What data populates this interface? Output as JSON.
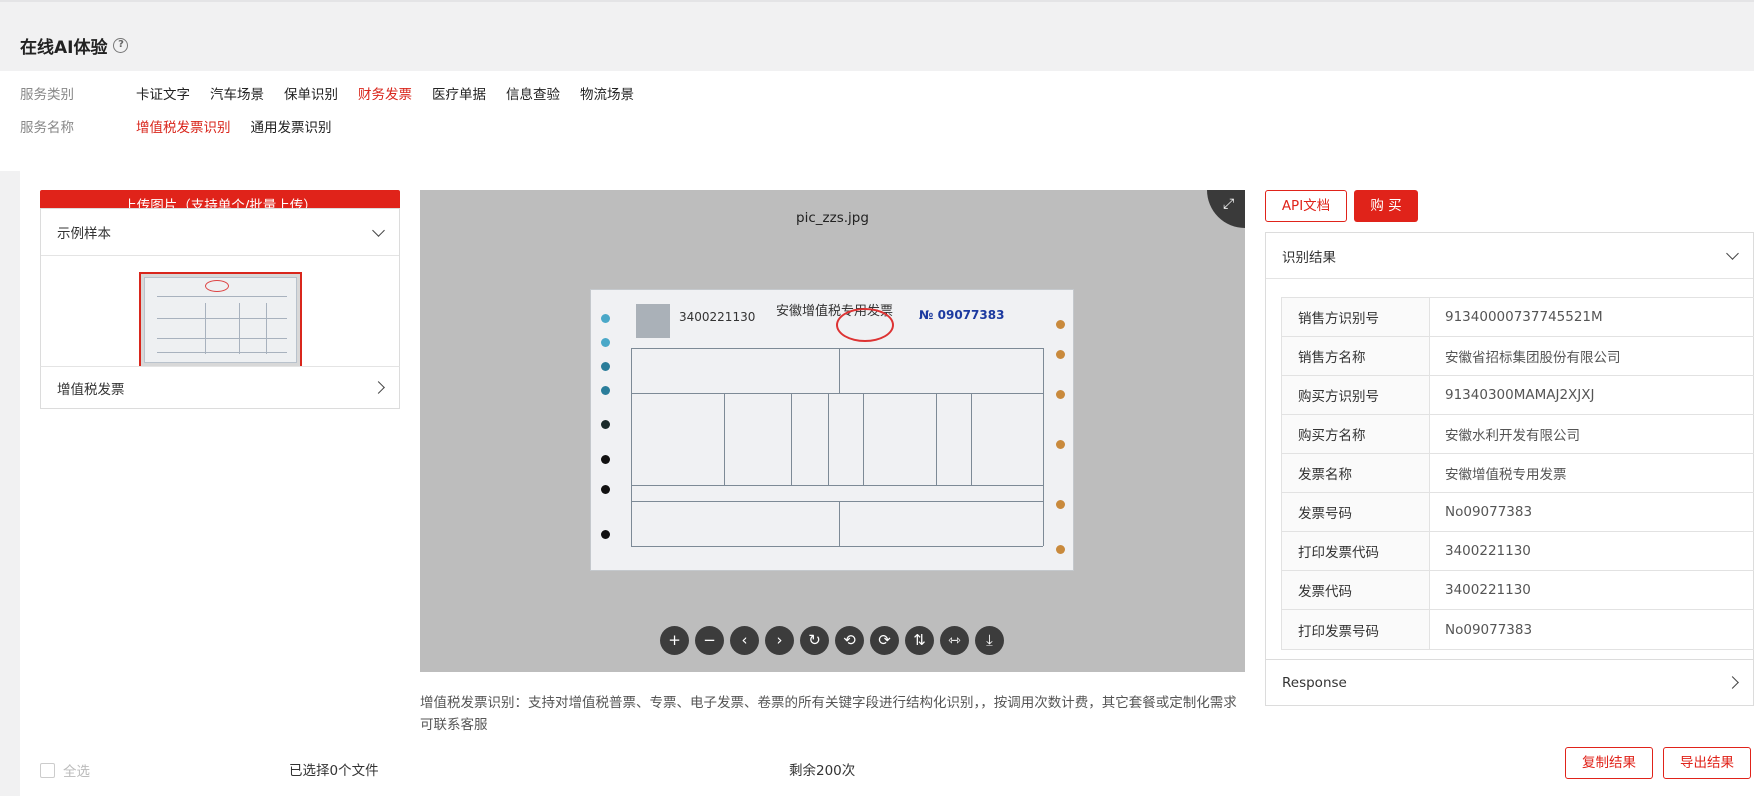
{
  "page": {
    "title": "在线AI体验"
  },
  "filters": {
    "category_label": "服务类别",
    "categories": [
      "卡证文字",
      "汽车场景",
      "保单识别",
      "财务发票",
      "医疗单据",
      "信息查验",
      "物流场景"
    ],
    "category_active": "财务发票",
    "service_label": "服务名称",
    "services": [
      "增值税发票识别",
      "通用发票识别"
    ],
    "service_active": "增值税发票识别"
  },
  "left": {
    "upload_label": "上传图片（支持单个/批量上传）",
    "samples_title": "示例样本",
    "vat_label": "增值税发票",
    "select_all": "全选",
    "selected_count": "已选择0个文件"
  },
  "viewer": {
    "filename": "pic_zzs.jpg",
    "invoice": {
      "title": "安徽增值税专用发票",
      "code": "3400221130",
      "number": "№ 09077383"
    },
    "tools": [
      {
        "name": "zoom-in-icon",
        "glyph": "+"
      },
      {
        "name": "zoom-out-icon",
        "glyph": "−"
      },
      {
        "name": "prev-icon",
        "glyph": "‹"
      },
      {
        "name": "next-icon",
        "glyph": "›"
      },
      {
        "name": "reset-icon",
        "glyph": "↻"
      },
      {
        "name": "rotate-left-icon",
        "glyph": "⟲"
      },
      {
        "name": "rotate-right-icon",
        "glyph": "⟳"
      },
      {
        "name": "flip-vertical-icon",
        "glyph": "⇅"
      },
      {
        "name": "flip-horizontal-icon",
        "glyph": "⇿"
      },
      {
        "name": "download-icon",
        "glyph": "⤓"
      }
    ]
  },
  "description": "增值税发票识别：支持对增值税普票、专票、电子发票、卷票的所有关键字段进行结构化识别，，按调用次数计费，其它套餐或定制化需求可联系客服",
  "remaining": "剩余200次",
  "right": {
    "api_doc": "API文档",
    "buy": "购 买",
    "result_title": "识别结果",
    "rows": [
      {
        "key": "销售方识别号",
        "value": "91340000737745521M"
      },
      {
        "key": "销售方名称",
        "value": "安徽省招标集团股份有限公司"
      },
      {
        "key": "购买方识别号",
        "value": "91340300MAMAJ2XJXJ"
      },
      {
        "key": "购买方名称",
        "value": "安徽水利开发有限公司"
      },
      {
        "key": "发票名称",
        "value": "安徽增值税专用发票"
      },
      {
        "key": "发票号码",
        "value": "No09077383"
      },
      {
        "key": "打印发票代码",
        "value": "3400221130"
      },
      {
        "key": "发票代码",
        "value": "3400221130"
      },
      {
        "key": "打印发票号码",
        "value": "No09077383"
      }
    ],
    "response_title": "Response",
    "copy_result": "复制结果",
    "export_result": "导出结果"
  }
}
